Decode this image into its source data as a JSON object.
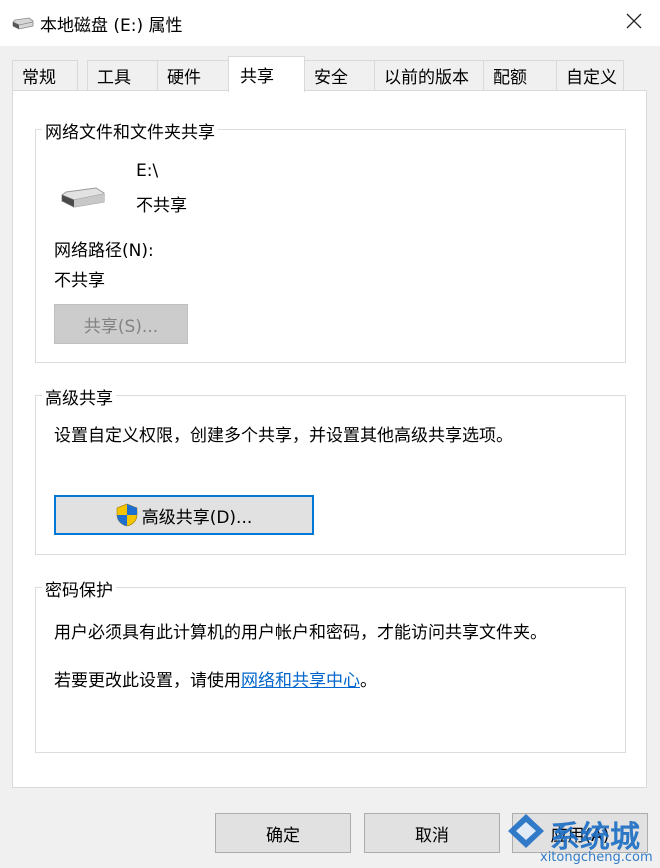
{
  "window": {
    "title": "本地磁盘 (E:) 属性",
    "close_glyph": "✕"
  },
  "tabs": [
    {
      "label": "常规"
    },
    {
      "label": "工具"
    },
    {
      "label": "硬件"
    },
    {
      "label": "共享",
      "active": true
    },
    {
      "label": "安全"
    },
    {
      "label": "以前的版本"
    },
    {
      "label": "配额"
    },
    {
      "label": "自定义"
    }
  ],
  "sharing": {
    "group_title": "网络文件和文件夹共享",
    "path": "E:\\",
    "status": "不共享",
    "network_path_label": "网络路径(N):",
    "network_path_value": "不共享",
    "share_button": "共享(S)..."
  },
  "advanced": {
    "group_title": "高级共享",
    "description": "设置自定义权限，创建多个共享，并设置其他高级共享选项。",
    "button": "高级共享(D)..."
  },
  "password": {
    "group_title": "密码保护",
    "line1": "用户必须具有此计算机的用户帐户和密码，才能访问共享文件夹。",
    "line2_prefix": "若要更改此设置，请使用",
    "line2_link": "网络和共享中心",
    "line2_suffix": "。"
  },
  "footer": {
    "ok": "确定",
    "cancel": "取消",
    "apply": "应用(A)"
  },
  "watermark": {
    "brand": "系统城",
    "url": "xitongcheng.com"
  },
  "colors": {
    "accent": "#0078d7",
    "link": "#0066cc",
    "watermark": "#1d6fc4"
  },
  "icons": {
    "drive": "drive-icon",
    "shield": "uac-shield-icon",
    "close": "close-icon"
  }
}
